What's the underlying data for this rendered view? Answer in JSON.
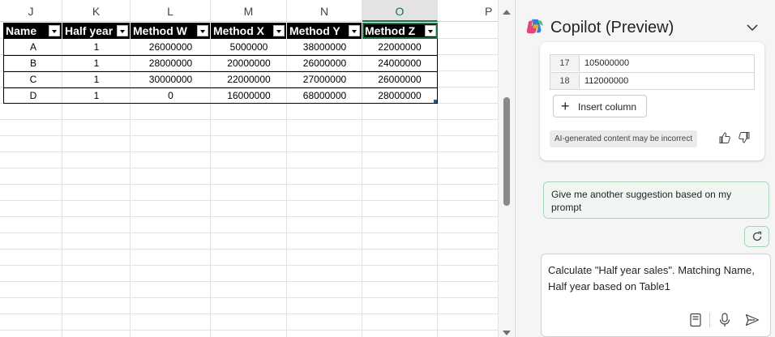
{
  "sheet": {
    "columns": [
      "J",
      "K",
      "L",
      "M",
      "N",
      "O",
      "P"
    ],
    "selected_column": "O",
    "table": {
      "headers": [
        "Name",
        "Half year",
        "Method W",
        "Method X",
        "Method Y",
        "Method Z"
      ],
      "rows": [
        [
          "A",
          "1",
          "26000000",
          "5000000",
          "38000000",
          "22000000"
        ],
        [
          "B",
          "1",
          "28000000",
          "20000000",
          "26000000",
          "24000000"
        ],
        [
          "C",
          "1",
          "30000000",
          "22000000",
          "27000000",
          "26000000"
        ],
        [
          "D",
          "1",
          "0",
          "16000000",
          "68000000",
          "28000000"
        ]
      ]
    }
  },
  "copilot": {
    "title": "Copilot (Preview)",
    "mini_table": [
      {
        "num": "17",
        "value": "105000000"
      },
      {
        "num": "18",
        "value": "112000000"
      }
    ],
    "insert_button": "Insert column",
    "ai_badge": "AI-generated content may be incorrect",
    "suggestion": "Give me another suggestion based on my prompt",
    "compose_text": "Calculate \"Half year sales\". Matching Name, Half year based on Table1",
    "icons": {
      "logo": "copilot-logo-icon",
      "chevron": "chevron-down-icon",
      "thumb_up": "thumbs-up-icon",
      "thumb_down": "thumbs-down-icon",
      "refresh": "refresh-icon",
      "prompts": "prompt-guide-icon",
      "mic": "microphone-icon",
      "send": "send-icon"
    },
    "colors": {
      "accent_green": "#1e7145",
      "suggestion_border": "#a8d5b8"
    }
  }
}
